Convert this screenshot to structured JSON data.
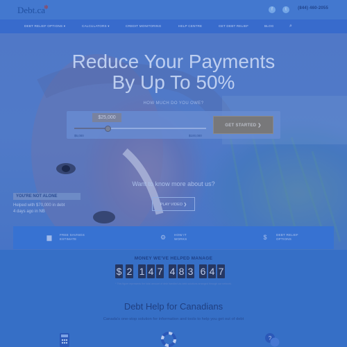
{
  "header": {
    "logo_text": "Debt.ca",
    "logo_leaf": "✻",
    "social": [
      {
        "icon": "facebook-icon",
        "glyph": "f"
      },
      {
        "icon": "twitter-icon",
        "glyph": "t"
      }
    ],
    "phone": "(844) 460-2055"
  },
  "nav": {
    "items": [
      "DEBT RELIEF OPTIONS ▾",
      "CALCULATORS ▾",
      "CREDIT MONITORING",
      "HELP CENTRE",
      "GET DEBT RELIEF",
      "BLOG"
    ],
    "search_icon": "⌕"
  },
  "hero": {
    "title_line1": "Reduce Your Payments",
    "title_line2": "By Up To 50%",
    "owe_question": "HOW MUCH DO YOU OWE?",
    "amount": "$25,000",
    "amount_fraction": 0.2,
    "range_min": "$5,000",
    "range_max": "$100,000",
    "cta": "GET STARTED  ❯",
    "want_more": "Want to know more about us?",
    "play_video": "PLAY VIDEO  ❯"
  },
  "testimonial": {
    "tag": "YOU'RE NOT ALONE",
    "line1": "Helped with $70,000 in debt",
    "line2": "4 days ago in NB"
  },
  "features": [
    {
      "icon": "piggy-bank-icon",
      "glyph": "▆",
      "line1": "FREE SAVINGS",
      "line2": "ESTIMATE"
    },
    {
      "icon": "gears-icon",
      "glyph": "⚙",
      "line1": "HOW IT",
      "line2": "WORKS"
    },
    {
      "icon": "dollar-icon",
      "glyph": "$",
      "line1": "DEBT RELIEF",
      "line2": "OPTIONS"
    }
  ],
  "money": {
    "title": "MONEY WE'VE HELPED MANAGE",
    "digits": [
      "$",
      "2",
      "1",
      "4",
      "7",
      "4",
      "8",
      "3",
      "6",
      "4",
      "7"
    ],
    "note": "* This figure represents the total amount of debt handled via debt solutions arranged through our network."
  },
  "section": {
    "title": "Debt Help for Canadians",
    "subtitle": "Canada's one-stop solution for information and tools to help you get out of debt"
  },
  "colors": {
    "accent": "#3c6fd0",
    "dark_text": "#1e3a74",
    "cta": "#8a7f6c"
  }
}
